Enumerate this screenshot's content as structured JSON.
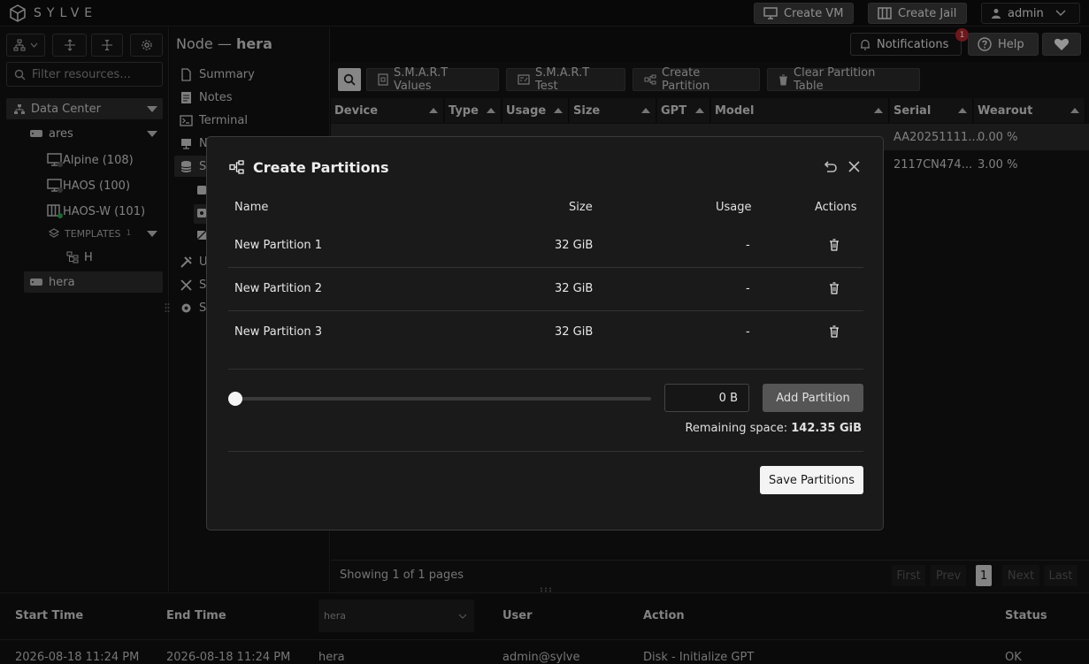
{
  "app": {
    "name": "SYLVE"
  },
  "topbar": {
    "create_vm": "Create VM",
    "create_jail": "Create Jail",
    "user": "admin"
  },
  "left": {
    "filter_placeholder": "Filter resources...",
    "datacenter": "Data Center",
    "nodes": [
      {
        "label": "ares"
      },
      {
        "label": "hera"
      }
    ],
    "vms": [
      {
        "label": "Alpine (108)"
      },
      {
        "label": "HAOS (100)"
      },
      {
        "label": "HAOS-W (101)"
      }
    ],
    "templates_label": "TEMPLATES",
    "templates_count": "1",
    "template_item": "H"
  },
  "node_header": {
    "prefix": "Node — ",
    "name": "hera"
  },
  "nav": {
    "items": [
      {
        "label": "Summary"
      },
      {
        "label": "Notes"
      },
      {
        "label": "Terminal"
      },
      {
        "label": "N"
      },
      {
        "label": "S"
      },
      {
        "label": "U"
      },
      {
        "label": "S"
      },
      {
        "label": "S"
      }
    ]
  },
  "header_right": {
    "notifications": "Notifications",
    "notif_count": "1",
    "help": "Help"
  },
  "toolbar": {
    "smart_values": "S.M.A.R.T Values",
    "smart_test": "S.M.A.R.T Test",
    "create_partition": "Create Partition",
    "clear_partition": "Clear Partition Table"
  },
  "table": {
    "columns": [
      "Device",
      "Type",
      "Usage",
      "Size",
      "GPT",
      "Model",
      "Serial",
      "Wearout"
    ],
    "rows": [
      {
        "serial": "AA20251111...",
        "wearout": "0.00 %"
      },
      {
        "serial": "2117CN474...",
        "wearout": "3.00 %"
      }
    ],
    "footer": "Showing 1 of 1 pages",
    "pager": {
      "first": "First",
      "prev": "Prev",
      "page": "1",
      "next": "Next",
      "last": "Last"
    }
  },
  "bottom": {
    "columns": {
      "start": "Start Time",
      "end": "End Time",
      "user": "User",
      "action": "Action",
      "status": "Status"
    },
    "node_select": "hera",
    "row": {
      "start": "2026-08-18 11:24 PM",
      "end": "2026-08-18 11:24 PM",
      "node": "hera",
      "user": "admin@sylve",
      "action": "Disk - Initialize GPT",
      "status": "OK"
    }
  },
  "modal": {
    "title": "Create Partitions",
    "columns": {
      "name": "Name",
      "size": "Size",
      "usage": "Usage",
      "actions": "Actions"
    },
    "partitions": [
      {
        "name": "New Partition 1",
        "size": "32 GiB",
        "usage": "-"
      },
      {
        "name": "New Partition 2",
        "size": "32 GiB",
        "usage": "-"
      },
      {
        "name": "New Partition 3",
        "size": "32 GiB",
        "usage": "-"
      }
    ],
    "slider_value": 0,
    "size_value": "0 B",
    "add_button": "Add Partition",
    "remaining_label": "Remaining space:",
    "remaining_value": "142.35 GiB",
    "save_button": "Save Partitions"
  }
}
